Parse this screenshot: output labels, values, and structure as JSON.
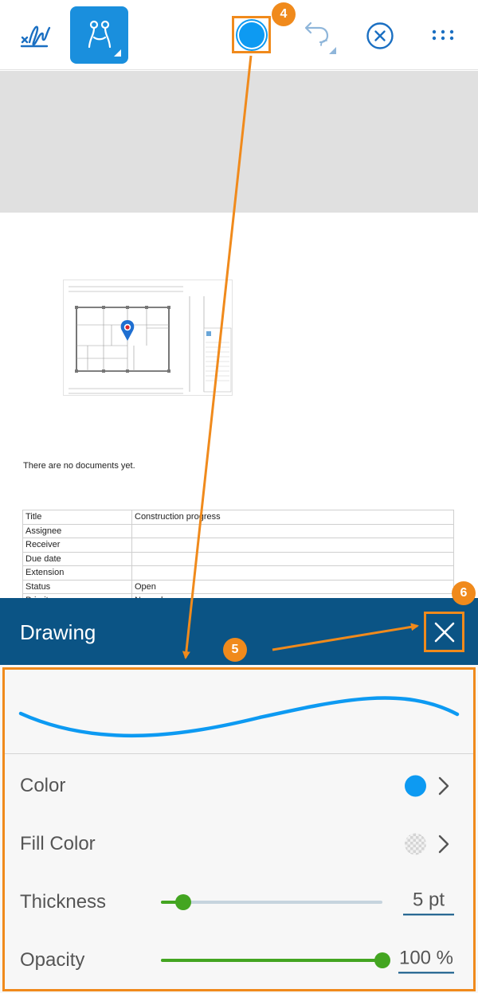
{
  "toolbar": {
    "tools": [
      {
        "icon": "signature-icon"
      },
      {
        "icon": "shape-tool-icon",
        "active": true
      },
      {
        "icon": "color-dot-icon"
      },
      {
        "icon": "undo-redo-icon"
      },
      {
        "icon": "close-circle-icon"
      },
      {
        "icon": "more-dots-icon"
      }
    ],
    "active_color": "#0d9af2",
    "accent_color": "#1a8fdd"
  },
  "annotations": {
    "step_4": "4",
    "step_5": "5",
    "step_6": "6",
    "highlight_color": "#f08a1c"
  },
  "document": {
    "empty_message": "There are no documents yet.",
    "table": [
      {
        "key": "Title",
        "value": "Construction progress"
      },
      {
        "key": "Assignee",
        "value": ""
      },
      {
        "key": "Receiver",
        "value": ""
      },
      {
        "key": "Due date",
        "value": ""
      },
      {
        "key": "Extension",
        "value": ""
      },
      {
        "key": "Status",
        "value": "Open"
      },
      {
        "key": "Priority",
        "value": "Normal"
      }
    ]
  },
  "drawing_panel": {
    "title": "Drawing",
    "header_color": "#0b5485",
    "preview_stroke_color": "#0d9af2",
    "color_label": "Color",
    "color_value": "#0d9af2",
    "fill_color_label": "Fill Color",
    "fill_color_value": "transparent",
    "thickness_label": "Thickness",
    "thickness_value": "5 pt",
    "thickness_fraction": 0.1,
    "opacity_label": "Opacity",
    "opacity_value": "100 %",
    "opacity_fraction": 1.0,
    "slider_color": "#43a521"
  }
}
